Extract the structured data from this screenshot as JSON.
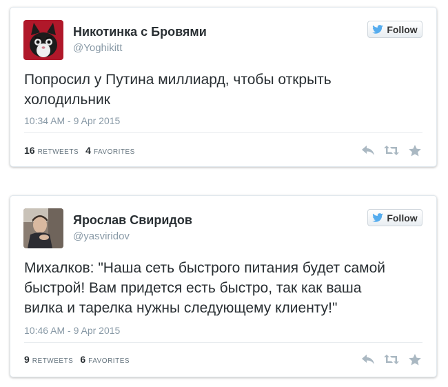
{
  "colors": {
    "twitter_blue": "#55acee",
    "muted_text": "#8899a6",
    "icon_gray": "#aab8c2",
    "card_border": "#e1e8ed"
  },
  "tweets": [
    {
      "name": "Никотинка с Бровями",
      "handle": "@Yoghikitt",
      "follow_label": "Follow",
      "text_lines": [
        "Попросил у Путина миллиард, чтобы открыть",
        "холодильник"
      ],
      "timestamp": "10:34 AM - 9 Apr 2015",
      "retweets": "16",
      "retweets_label": "RETWEETS",
      "favorites": "4",
      "favorites_label": "FAVORITES",
      "icons": [
        "reply-icon",
        "retweet-icon",
        "favorite-star-icon"
      ]
    },
    {
      "name": "Ярослав Свиридов",
      "handle": "@yasviridov",
      "follow_label": "Follow",
      "text_lines": [
        "Михалков: \"Наша сеть быстрого питания будет самой",
        "быстрой! Вам придется есть быстро, так как ваша",
        "вилка и тарелка нужны следующему клиенту!\""
      ],
      "timestamp": "10:46 AM - 9 Apr 2015",
      "retweets": "9",
      "retweets_label": "RETWEETS",
      "favorites": "6",
      "favorites_label": "FAVORITES",
      "icons": [
        "reply-icon",
        "retweet-icon",
        "favorite-star-icon"
      ]
    }
  ]
}
